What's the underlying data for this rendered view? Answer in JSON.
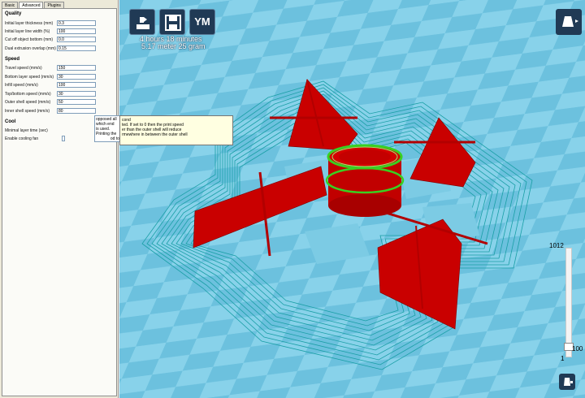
{
  "tabs": [
    {
      "label": "Basic"
    },
    {
      "label": "Advanced"
    },
    {
      "label": "Plugins"
    }
  ],
  "quality": {
    "title": "Quality",
    "fields": [
      {
        "label": "Initial layer thickness (mm)",
        "value": "0.3"
      },
      {
        "label": "Initial layer line width (%)",
        "value": "100"
      },
      {
        "label": "Cut off object bottom (mm)",
        "value": "0.0"
      },
      {
        "label": "Dual extrusion overlap (mm)",
        "value": "0.15"
      }
    ]
  },
  "speed": {
    "title": "Speed",
    "fields": [
      {
        "label": "Travel speed (mm/s)",
        "value": "150"
      },
      {
        "label": "Bottom layer speed (mm/s)",
        "value": "30"
      },
      {
        "label": "Infill speed (mm/s)",
        "value": "100"
      },
      {
        "label": "Top/bottom speed (mm/s)",
        "value": "30"
      },
      {
        "label": "Outer shell speed (mm/s)",
        "value": "50"
      },
      {
        "label": "Inner shell speed (mm/s)",
        "value": "80"
      }
    ]
  },
  "cool": {
    "title": "Cool",
    "fields": [
      {
        "label": "Minimal layer time (sec)",
        "value": "10"
      },
      {
        "label": "Enable cooling fan",
        "value": ""
      }
    ]
  },
  "tooltip": {
    "line1": "cond",
    "line2": "ted. If set to 0 then the print speed",
    "line3": "er than the outer shell will reduce",
    "line4": "rmewhere in between the outer shell"
  },
  "tooltip_behind": {
    "line1": "opposed all which end",
    "line2": "is used. Printing the",
    "line3": "od to"
  },
  "toolbar": {
    "load_icon": "load-icon",
    "save_icon": "save-sd-icon",
    "ym_label": "YM"
  },
  "print_info": {
    "time": "4 hours 18 minutes",
    "amount": "5.17 meter 25 gram"
  },
  "layers": {
    "max": "1012",
    "current": "100",
    "min": "1",
    "fraction": 0.099
  },
  "colors": {
    "viewport_bg": "#6fc3df",
    "model_red": "#cc0000",
    "toolpath_cyan": "#1aa5a5",
    "highlight_green": "#3cd020",
    "button_navy": "#203a55"
  }
}
